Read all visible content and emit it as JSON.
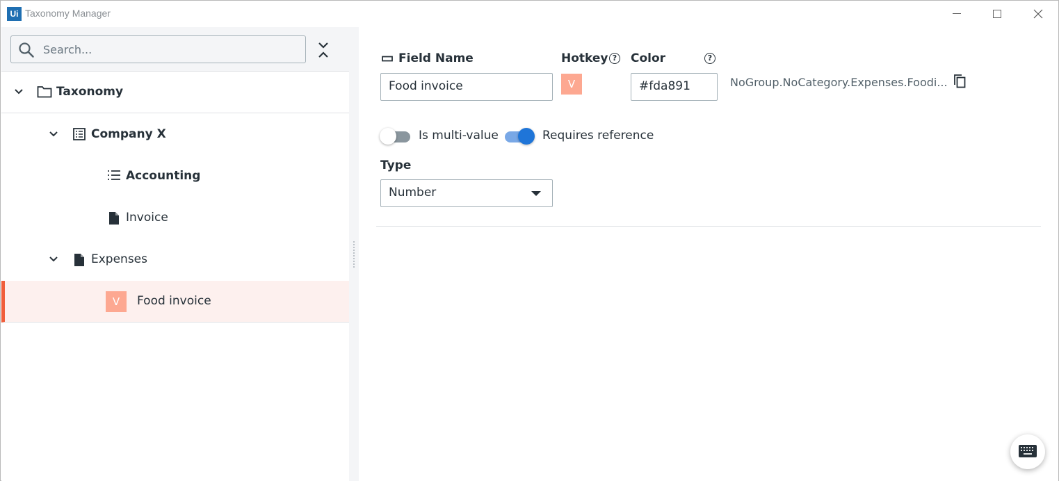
{
  "window": {
    "logo_text": "Ui",
    "title": "Taxonomy Manager"
  },
  "search": {
    "placeholder": "Search..."
  },
  "tree": {
    "items": [
      {
        "label": "Taxonomy",
        "icon": "folder-icon"
      },
      {
        "label": "Company X",
        "icon": "group-icon"
      },
      {
        "label": "Accounting",
        "icon": "list-icon"
      },
      {
        "label": "Invoice",
        "icon": "document-icon"
      },
      {
        "label": "Expenses",
        "icon": "document-icon"
      },
      {
        "label": "Food invoice",
        "badge": "V",
        "badge_color": "#fda891",
        "selected": true
      }
    ]
  },
  "field": {
    "field_name_label": "Field Name",
    "field_name_value": "Food invoice",
    "hotkey_label": "Hotkey",
    "hotkey_value": "V",
    "color_label": "Color",
    "color_value": "#fda891",
    "full_path": "NoGroup.NoCategory.Expenses.Foodi...",
    "multi_value_label": "Is multi-value",
    "multi_value_on": false,
    "requires_reference_label": "Requires reference",
    "requires_reference_on": true,
    "type_label": "Type",
    "type_value": "Number"
  },
  "colors": {
    "accent": "#1f75d8",
    "selection_bar": "#f05e3b",
    "hotkey_badge": "#fda891"
  }
}
